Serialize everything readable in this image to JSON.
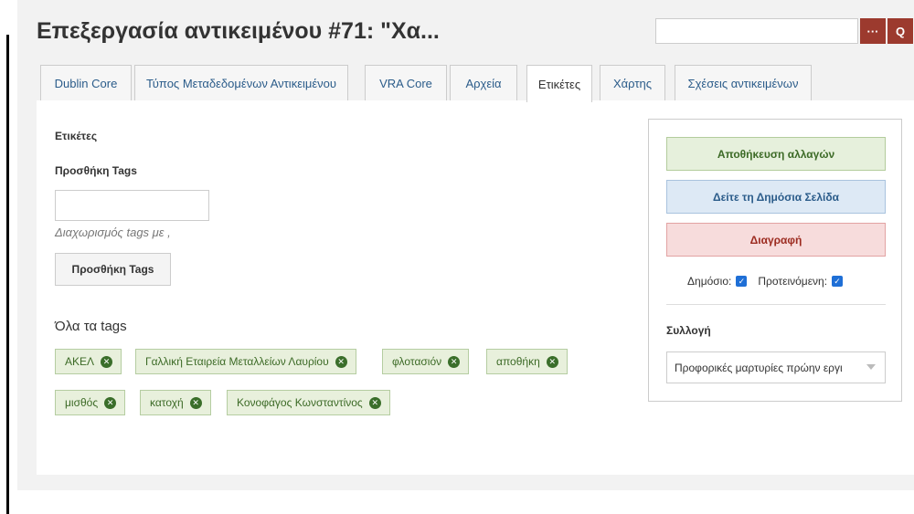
{
  "header": {
    "title": "Επεξεργασία αντικειμένου #71: \"Χα...",
    "search": {
      "value": "",
      "placeholder": ""
    },
    "options_label": "···",
    "search_label": "Q"
  },
  "tabs": [
    {
      "label": "Dublin Core"
    },
    {
      "label": "Τύπος Μεταδεδομένων Αντικειμένου"
    },
    {
      "label": "VRA Core"
    },
    {
      "label": "Αρχεία"
    },
    {
      "label": "Ετικέτες"
    },
    {
      "label": "Χάρτης"
    },
    {
      "label": "Σχέσεις αντικειμένων"
    }
  ],
  "main": {
    "section_label": "Ετικέτες",
    "add_label": "Προσθήκη Tags",
    "add_input_value": "",
    "hint": "Διαχωρισμός tags με ,",
    "add_button": "Προσθήκη Tags",
    "all_tags_label": "Όλα τα tags",
    "tags": [
      "ΑΚΕΛ",
      "Γαλλική Εταιρεία Μεταλλείων Λαυρίου",
      "φλοτασιόν",
      "αποθήκη",
      "μισθός",
      "κατοχή",
      "Κονοφάγος Κωνσταντίνος"
    ],
    "remove_glyph": "✕"
  },
  "sidebar": {
    "save_button": "Αποθήκευση αλλαγών",
    "view_button": "Δείτε τη Δημόσια Σελίδα",
    "delete_button": "Διαγραφή",
    "public_label": "Δημόσιο:",
    "featured_label": "Προτεινόμενη:",
    "public_checked": true,
    "featured_checked": true,
    "check_glyph": "✓",
    "collection_label": "Συλλογή",
    "collection_value": "Προφορικές μαρτυρίες πρώην εργι"
  },
  "colors": {
    "accent": "#9c3a2e",
    "tab_link": "#2b5c8a",
    "tag_green": "#3c6a26",
    "checkbox": "#1f6fd6"
  }
}
